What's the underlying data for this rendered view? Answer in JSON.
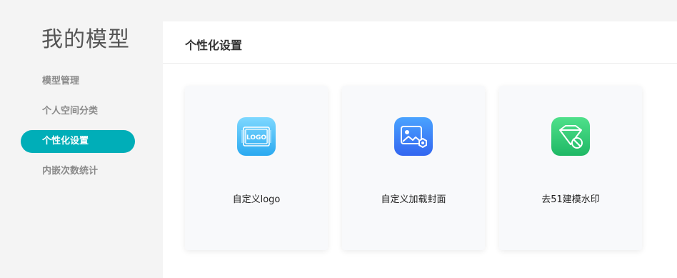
{
  "sidebar": {
    "title": "我的模型",
    "items": [
      {
        "label": "模型管理",
        "active": false
      },
      {
        "label": "个人空间分类",
        "active": false
      },
      {
        "label": "个性化设置",
        "active": true
      },
      {
        "label": "内嵌次数统计",
        "active": false
      }
    ]
  },
  "main": {
    "title": "个性化设置",
    "cards": [
      {
        "label": "自定义logo",
        "icon": "logo-icon",
        "color_top": "#7ed8ff",
        "color_bottom": "#2aa9f0"
      },
      {
        "label": "自定义加载封面",
        "icon": "image-settings-icon",
        "color_top": "#4aa3ff",
        "color_bottom": "#3366f0"
      },
      {
        "label": "去51建模水印",
        "icon": "remove-watermark-icon",
        "color_top": "#4fe08a",
        "color_bottom": "#1fb865"
      }
    ]
  },
  "colors": {
    "accent": "#00aeb8",
    "sidebar_bg": "#f4f4f4",
    "card_bg": "#f8f9fb"
  }
}
